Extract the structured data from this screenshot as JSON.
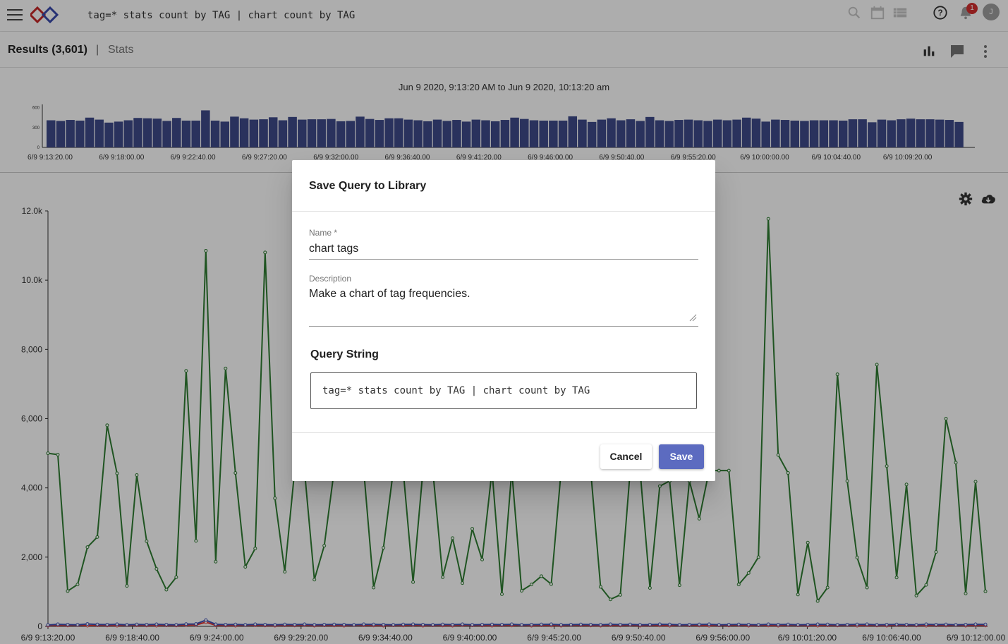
{
  "topbar": {
    "query": "tag=* stats count by TAG | chart count by TAG",
    "notification_count": "1",
    "avatar_initial": "J",
    "icons": [
      "menu-icon",
      "logo-icon",
      "search-icon",
      "calendar-icon",
      "list-icon",
      "help-icon",
      "bell-icon"
    ]
  },
  "subbar": {
    "results_label": "Results (3,601)",
    "separator": "|",
    "stats_label": "Stats",
    "icons": [
      "bar-chart-icon",
      "comment-icon",
      "more-vert-icon"
    ]
  },
  "overview": {
    "range": "Jun 9 2020, 9:13:20 AM to Jun 9 2020, 10:13:20 am",
    "y_ticks": [
      "600",
      "300",
      "0"
    ],
    "x_ticks": [
      "6/9 9:13:20.00",
      "6/9 9:18:00.00",
      "6/9 9:22:40.00",
      "6/9 9:27:20.00",
      "6/9 9:32:00.00",
      "6/9 9:36:40.00",
      "6/9 9:41:20.00",
      "6/9 9:46:00.00",
      "6/9 9:50:40.00",
      "6/9 9:55:20.00",
      "6/9 10:00:00.00",
      "6/9 10:04:40.00",
      "6/9 10:09:20.00"
    ],
    "bar_color": "#3f4a8a",
    "bars": [
      410,
      400,
      415,
      405,
      450,
      420,
      375,
      390,
      410,
      445,
      440,
      435,
      400,
      445,
      405,
      405,
      560,
      405,
      390,
      465,
      440,
      420,
      425,
      455,
      410,
      460,
      420,
      425,
      425,
      430,
      395,
      400,
      465,
      430,
      415,
      440,
      440,
      420,
      410,
      395,
      420,
      400,
      415,
      390,
      420,
      410,
      395,
      415,
      450,
      430,
      410,
      405,
      405,
      405,
      470,
      420,
      385,
      420,
      440,
      410,
      425,
      400,
      460,
      410,
      400,
      415,
      420,
      410,
      400,
      420,
      410,
      420,
      450,
      435,
      390,
      420,
      415,
      405,
      400,
      410,
      410,
      410,
      405,
      425,
      425,
      380,
      420,
      410,
      425,
      435,
      425,
      425,
      420,
      415,
      385
    ],
    "ymax": 650
  },
  "chart": {
    "type": "line",
    "icons": [
      "gear-icon",
      "cloud-download-icon"
    ],
    "y_ticks": [
      "12.0k",
      "10.0k",
      "8,000",
      "6,000",
      "4,000",
      "2,000",
      "0"
    ],
    "x_ticks": [
      "6/9 9:13:20.00",
      "6/9 9:18:40.00",
      "6/9 9:24:00.00",
      "6/9 9:29:20.00",
      "6/9 9:34:40.00",
      "6/9 9:40:00.00",
      "6/9 9:45:20.00",
      "6/9 9:50:40.00",
      "6/9 9:56:00.00",
      "6/9 10:01:20.00",
      "6/9 10:06:40.00",
      "6/9 10:12:00.00"
    ]
  },
  "chart_data": {
    "type": "line",
    "ylim": [
      0,
      12000
    ],
    "x_start": "6/9 9:13:20.00",
    "x_step_seconds": 40,
    "series": [
      {
        "color": "#2e7d32",
        "values": [
          5000,
          4960,
          1020,
          1210,
          2290,
          2580,
          5810,
          4420,
          1170,
          4370,
          2460,
          1660,
          1060,
          1420,
          7380,
          2470,
          10850,
          1870,
          7450,
          4430,
          1720,
          2250,
          10800,
          3700,
          1580,
          4500,
          4500,
          1350,
          2330,
          4500,
          4500,
          4500,
          4500,
          1120,
          2270,
          4500,
          4500,
          1280,
          4500,
          4500,
          1420,
          2550,
          1250,
          2820,
          1930,
          4500,
          930,
          4500,
          1030,
          1210,
          1450,
          1220,
          4500,
          4500,
          4500,
          4500,
          1140,
          780,
          910,
          4500,
          4500,
          1110,
          4050,
          4200,
          1190,
          4200,
          3110,
          4500,
          4500,
          4500,
          1210,
          1540,
          2000,
          11770,
          4950,
          4430,
          920,
          2420,
          730,
          1120,
          7280,
          4200,
          1990,
          1120,
          7560,
          4630,
          1410,
          4100,
          890,
          1200,
          2150,
          6000,
          4730,
          950,
          4180,
          1010
        ]
      },
      {
        "color": "#3f51b5",
        "values": [
          40,
          60,
          50,
          45,
          70,
          55,
          50,
          60,
          45,
          55,
          50,
          60,
          50,
          45,
          65,
          70,
          180,
          60,
          50,
          55,
          45,
          60,
          50,
          45,
          55,
          50,
          60,
          45,
          50,
          55,
          50,
          45,
          60,
          55,
          50,
          45,
          55,
          60,
          50,
          45,
          55,
          50,
          60,
          45,
          50,
          55,
          50,
          60,
          45,
          50,
          55,
          60,
          45,
          50,
          55,
          50,
          45,
          60,
          50,
          55,
          45,
          50,
          60,
          55,
          45,
          50,
          55,
          60,
          45,
          50,
          55,
          50,
          45,
          60,
          50,
          55,
          45,
          50,
          60,
          55,
          45,
          50,
          55,
          60,
          45,
          50,
          55,
          50,
          45,
          60,
          50,
          55,
          45,
          50,
          60,
          55
        ]
      },
      {
        "color": "#e53935",
        "values": [
          20,
          30,
          25,
          35,
          20,
          30,
          25,
          20,
          35,
          30,
          25,
          20,
          30,
          25,
          35,
          40,
          120,
          30,
          25,
          20,
          35,
          30,
          25,
          20,
          30,
          25,
          35,
          20,
          30,
          25,
          20,
          35,
          30,
          25,
          20,
          30,
          25,
          35,
          20,
          30,
          25,
          20,
          35,
          30,
          25,
          20,
          30,
          25,
          35,
          20,
          30,
          25,
          20,
          35,
          30,
          25,
          20,
          30,
          25,
          35,
          20,
          30,
          25,
          20,
          35,
          30,
          25,
          20,
          30,
          25,
          35,
          20,
          30,
          25,
          20,
          35,
          30,
          25,
          20,
          30,
          25,
          35,
          20,
          30,
          25,
          20,
          35,
          30,
          25,
          20,
          30,
          25,
          35,
          20,
          30,
          25
        ]
      }
    ]
  },
  "dialog": {
    "title": "Save Query to Library",
    "name_label": "Name *",
    "name_value": "chart tags",
    "description_label": "Description",
    "description_value": "Make a chart of tag frequencies.",
    "query_string_label": "Query String",
    "query_string": "tag=* stats count by TAG | chart count by TAG",
    "cancel_label": "Cancel",
    "save_label": "Save",
    "accent_color": "#5c6bc0"
  }
}
